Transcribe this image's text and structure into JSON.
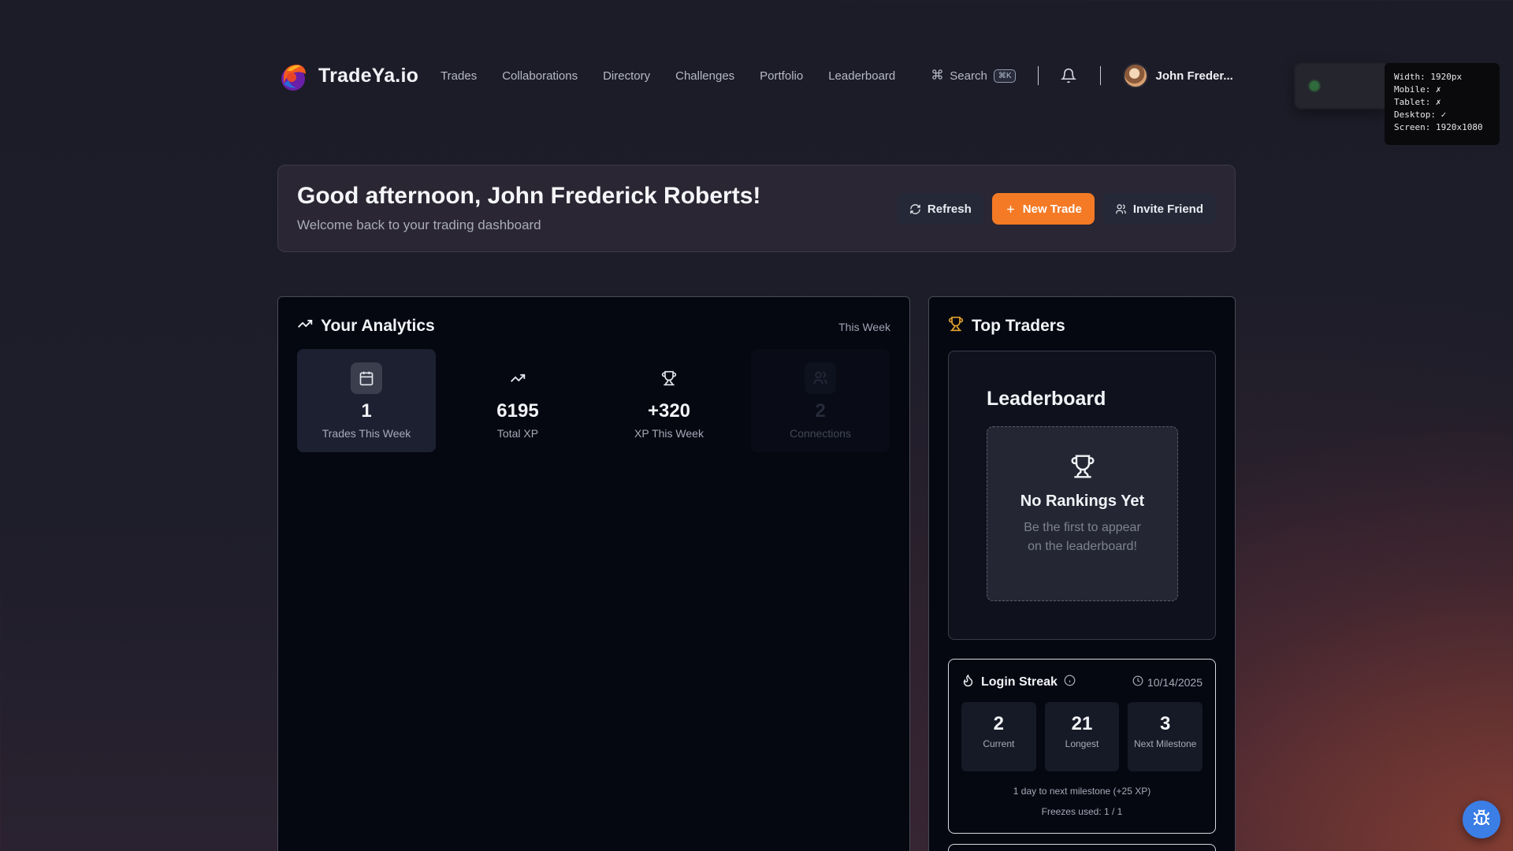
{
  "app": {
    "name": "TradeYa.io"
  },
  "nav": {
    "links": [
      "Trades",
      "Collaborations",
      "Directory",
      "Challenges",
      "Portfolio",
      "Leaderboard"
    ],
    "search_label": "Search",
    "search_shortcut": "⌘K",
    "user_name": "John Freder..."
  },
  "debug": {
    "lines": [
      "Width: 1920px",
      "Mobile: ✗",
      "Tablet: ✗",
      "Desktop: ✓",
      "Screen: 1920x1080"
    ]
  },
  "welcome": {
    "title": "Good afternoon, John Frederick Roberts!",
    "subtitle": "Welcome back to your trading dashboard",
    "refresh_label": "Refresh",
    "new_trade_label": "New Trade",
    "invite_label": "Invite Friend"
  },
  "analytics": {
    "title": "Your Analytics",
    "period": "This Week",
    "stats": [
      {
        "value": "1",
        "label": "Trades This Week",
        "icon": "calendar-icon"
      },
      {
        "value": "6195",
        "label": "Total XP",
        "icon": "trending-up-icon"
      },
      {
        "value": "+320",
        "label": "XP This Week",
        "icon": "trophy-icon"
      },
      {
        "value": "2",
        "label": "Connections",
        "icon": "users-icon"
      }
    ]
  },
  "top_traders": {
    "title": "Top Traders",
    "leaderboard_title": "Leaderboard",
    "empty_title": "No Rankings Yet",
    "empty_text": "Be the first to appear on the leaderboard!"
  },
  "streak": {
    "title": "Login Streak",
    "date": "10/14/2025",
    "boxes": [
      {
        "value": "2",
        "label": "Current"
      },
      {
        "value": "21",
        "label": "Longest"
      },
      {
        "value": "3",
        "label": "Next Milestone"
      }
    ],
    "note": "1 day to next milestone (+25 XP)",
    "freezes": "Freezes used: 1 / 1"
  },
  "colors": {
    "accent": "#f47a25",
    "fab": "#3b7ee6",
    "trophy": "#e2a22c"
  }
}
